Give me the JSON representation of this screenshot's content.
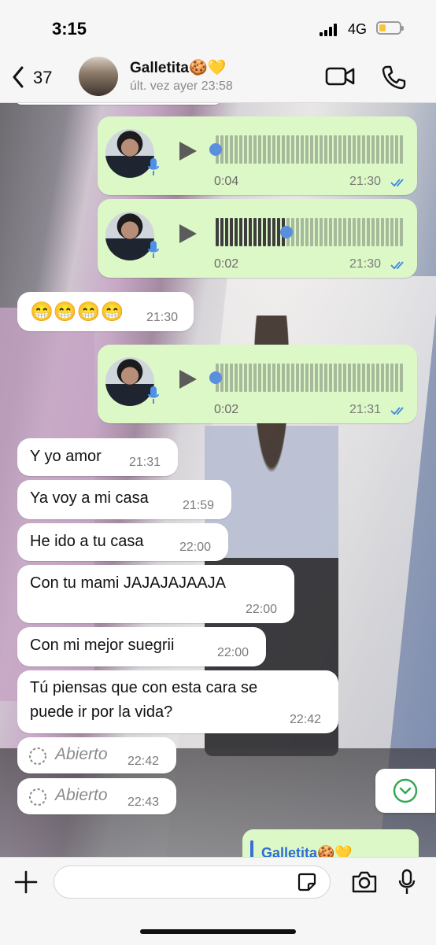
{
  "status": {
    "time": "3:15",
    "network": "4G",
    "battery_level": 0.35
  },
  "header": {
    "back_count": "37",
    "name": "Galletita🍪💛",
    "last_seen": "últ. vez ayer 23:58"
  },
  "voice_notes": [
    {
      "duration": "0:04",
      "time": "21:30",
      "progress": 0.0,
      "status": "read"
    },
    {
      "duration": "0:02",
      "time": "21:30",
      "progress": 0.37,
      "status": "read"
    },
    {
      "duration": "0:02",
      "time": "21:31",
      "progress": 0.0,
      "status": "read"
    }
  ],
  "messages": [
    {
      "text": "😁😁😁😁",
      "time": "21:30",
      "direction": "in"
    },
    {
      "text": "Y yo amor",
      "time": "21:31",
      "direction": "in"
    },
    {
      "text": "Ya voy a mi casa",
      "time": "21:59",
      "direction": "in"
    },
    {
      "text": "He ido a tu casa",
      "time": "22:00",
      "direction": "in"
    },
    {
      "text": "Con tu mami JAJAJAJAAJA",
      "time": "22:00",
      "direction": "in"
    },
    {
      "text": "Con mi mejor suegrii",
      "time": "22:00",
      "direction": "in"
    },
    {
      "text_line1": "Tú piensas que con esta cara se",
      "text_line2": "puede ir por la vida?",
      "time": "22:42",
      "direction": "in"
    }
  ],
  "opened": [
    {
      "label": "Abierto",
      "time": "22:42"
    },
    {
      "label": "Abierto",
      "time": "22:43"
    }
  ],
  "reply_quote": {
    "name": "Galletita🍪💛"
  },
  "composer": {
    "placeholder": ""
  },
  "colors": {
    "outgoing": "#dcf8c6",
    "incoming": "#ffffff",
    "ticks": "#3b8be0",
    "accent": "#2fa84f"
  }
}
